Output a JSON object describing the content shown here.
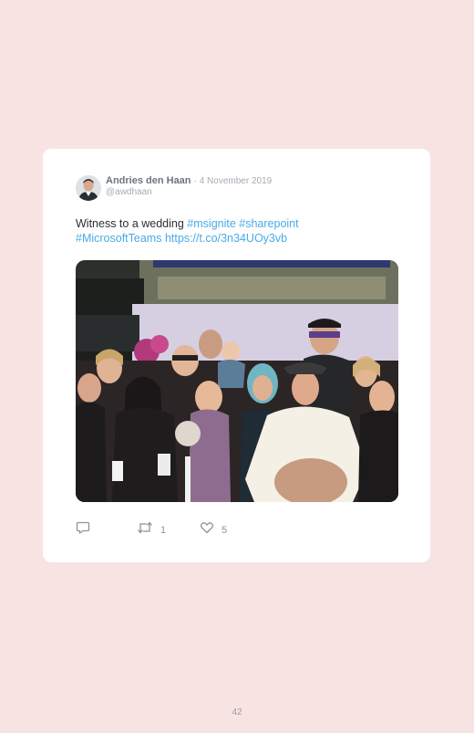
{
  "tweet": {
    "author_name": "Andries den Haan",
    "date": "· 4 November 2019",
    "handle": "@awdhaan",
    "text_prefix": "Witness to a wedding ",
    "tag_msignite": "#msignite",
    "tag_sharepoint": "#sharepoint",
    "tag_teams": "#MicrosoftTeams",
    "link": "https://t.co/3n34UOy3vb",
    "retweet_count": "1",
    "like_count": "5",
    "colors": {
      "link": "#4aaae6",
      "name": "#6b7480",
      "muted": "#a3acb4"
    },
    "icons": [
      "reply-icon",
      "retweet-icon",
      "heart-icon"
    ]
  },
  "page": {
    "number": "42",
    "background": "#f8e3e3"
  }
}
